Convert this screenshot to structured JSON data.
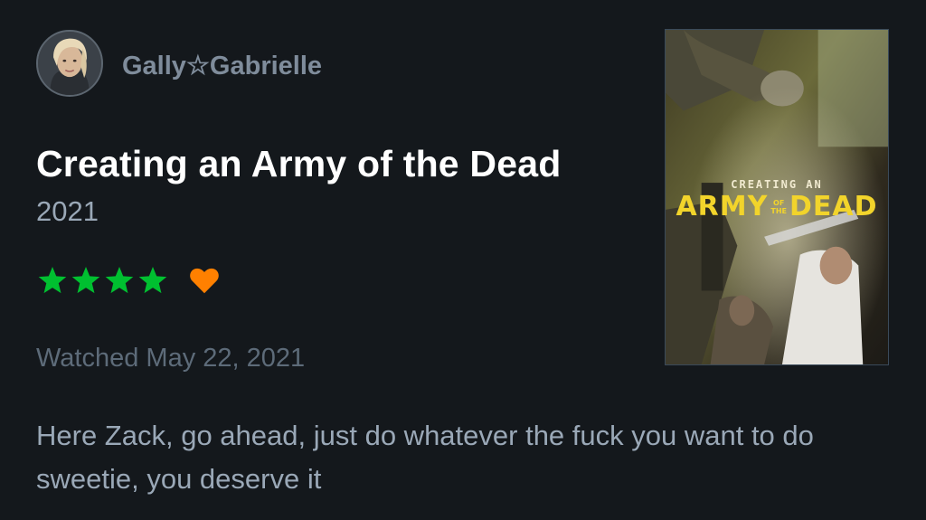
{
  "user": {
    "name": "Gally☆Gabrielle"
  },
  "film": {
    "title": "Creating an Army of the Dead",
    "year": "2021"
  },
  "rating": {
    "stars": 4,
    "liked": true,
    "star_color": "#00c030",
    "heart_color": "#ff8000"
  },
  "watched": "Watched May 22, 2021",
  "review": "Here Zack, go ahead, just do whatever the fuck you want to do sweetie, you deserve it",
  "poster": {
    "top_line": "CREATING AN",
    "army": "ARMY",
    "of": "OF",
    "the": "THE",
    "dead": "DEAD"
  }
}
